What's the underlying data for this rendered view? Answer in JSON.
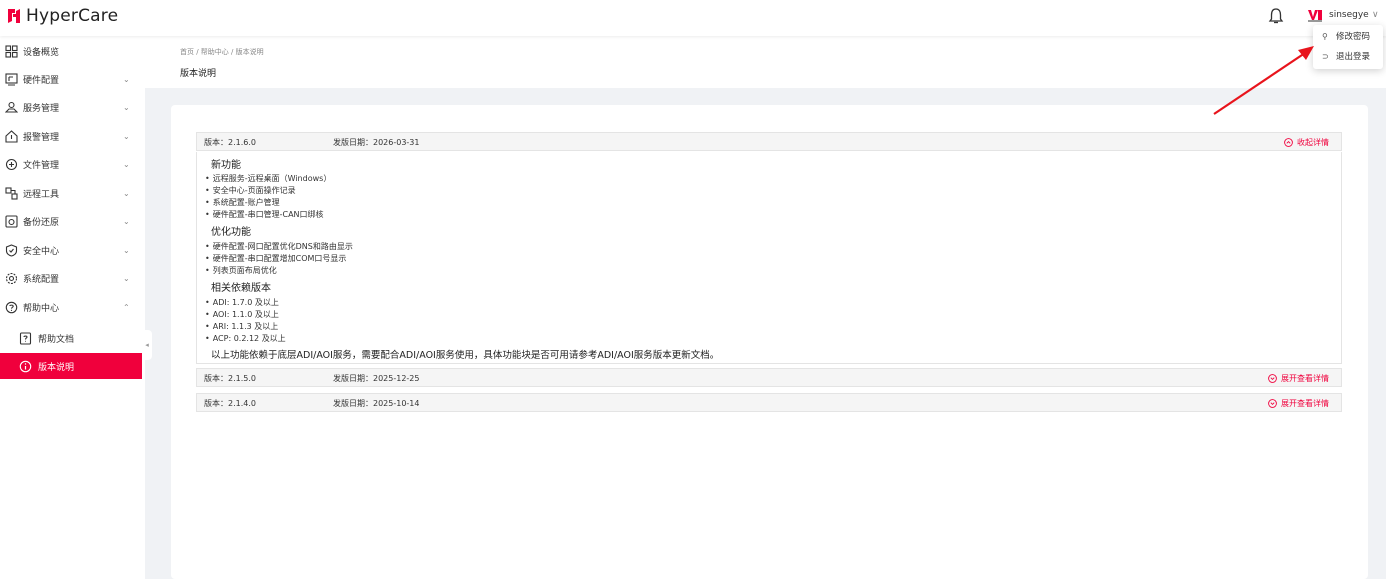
{
  "app": {
    "name": "HyperCare"
  },
  "user": {
    "name": "sinsegye"
  },
  "colors": {
    "accent": "#f0003c",
    "sidebar_bg": "#ffffff",
    "page_bg": "#f0f2f5"
  },
  "user_menu": {
    "items": [
      {
        "label": "修改密码",
        "icon": "key-icon"
      },
      {
        "label": "退出登录",
        "icon": "logout-icon"
      }
    ]
  },
  "sidebar": {
    "items": [
      {
        "label": "设备概览",
        "icon": "grid-icon",
        "has_chevron": false
      },
      {
        "label": "硬件配置",
        "icon": "monitor-icon",
        "has_chevron": true,
        "chevron": "⌄"
      },
      {
        "label": "服务管理",
        "icon": "service-icon",
        "has_chevron": true,
        "chevron": "⌄"
      },
      {
        "label": "报警管理",
        "icon": "alarm-icon",
        "has_chevron": true,
        "chevron": "⌄"
      },
      {
        "label": "文件管理",
        "icon": "file-icon",
        "has_chevron": true,
        "chevron": "⌄"
      },
      {
        "label": "远程工具",
        "icon": "remote-icon",
        "has_chevron": true,
        "chevron": "⌄"
      },
      {
        "label": "备份还原",
        "icon": "backup-icon",
        "has_chevron": true,
        "chevron": "⌄"
      },
      {
        "label": "安全中心",
        "icon": "shield-icon",
        "has_chevron": true,
        "chevron": "⌄"
      },
      {
        "label": "系统配置",
        "icon": "settings-icon",
        "has_chevron": true,
        "chevron": "⌄"
      },
      {
        "label": "帮助中心",
        "icon": "help-icon",
        "has_chevron": true,
        "chevron": "⌃"
      }
    ],
    "sub_items": [
      {
        "label": "帮助文档",
        "icon": "doc-icon",
        "active": false
      },
      {
        "label": "版本说明",
        "icon": "info-icon",
        "active": true
      }
    ]
  },
  "breadcrumb": {
    "text": "首页 / 帮助中心 / 版本说明"
  },
  "page_title": "版本说明",
  "versions": [
    {
      "version": "版本：2.1.6.0",
      "date": "发版日期：2026-03-31",
      "toggle": "收起详情",
      "expanded": true,
      "sections": [
        {
          "title": "新功能",
          "items": [
            "远程服务-远程桌面（Windows）",
            "安全中心-页面操作记录",
            "系统配置-账户管理",
            "硬件配置-串口管理-CAN口绑核"
          ]
        },
        {
          "title": "优化功能",
          "items": [
            "硬件配置-网口配置优化DNS和路由显示",
            "硬件配置-串口配置增加COM口号显示",
            "列表页面布局优化"
          ]
        },
        {
          "title": "相关依赖版本",
          "items": [
            "ADI: 1.7.0 及以上",
            "AOI: 1.1.0 及以上",
            "ARI: 1.1.3 及以上",
            "ACP: 0.2.12 及以上"
          ]
        }
      ],
      "note": "以上功能依赖于底层ADI/AOI服务，需要配合ADI/AOI服务使用，具体功能块是否可用请参考ADI/AOI服务版本更新文档。"
    },
    {
      "version": "版本：2.1.5.0",
      "date": "发版日期：2025-12-25",
      "toggle": "展开查看详情",
      "expanded": false
    },
    {
      "version": "版本：2.1.4.0",
      "date": "发版日期：2025-10-14",
      "toggle": "展开查看详情",
      "expanded": false
    }
  ]
}
